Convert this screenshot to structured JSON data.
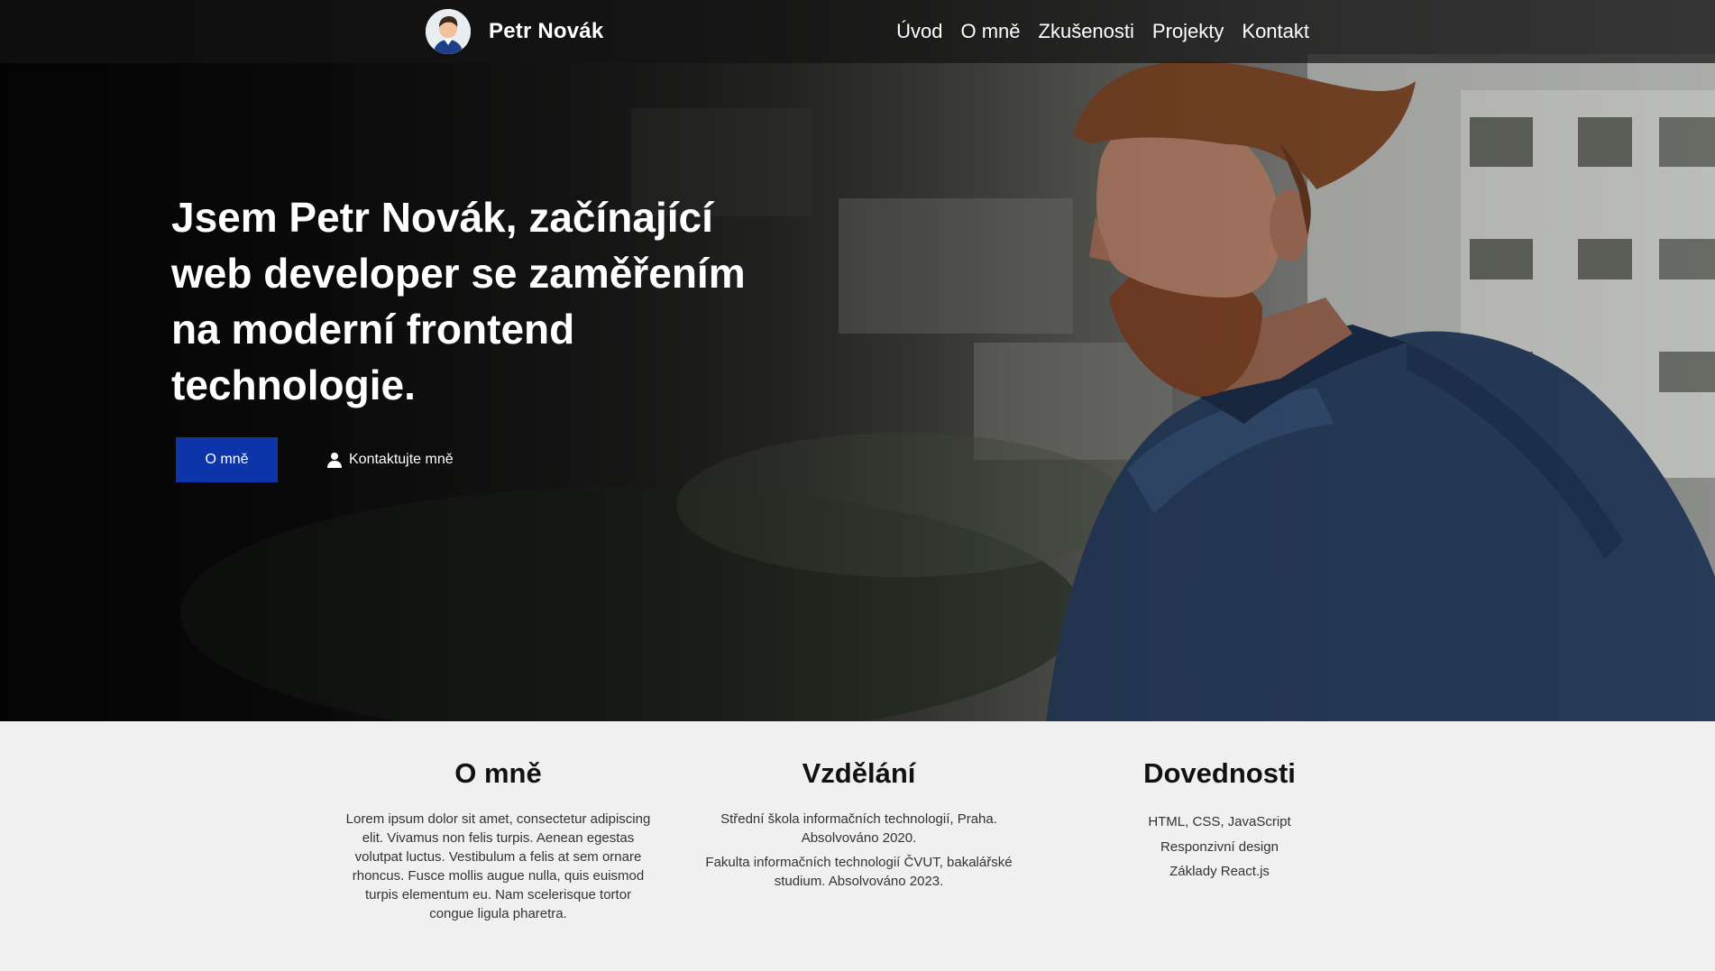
{
  "header": {
    "brand_name": "Petr Novák",
    "nav": [
      "Úvod",
      "O mně",
      "Zkušenosti",
      "Projekty",
      "Kontakt"
    ]
  },
  "hero": {
    "title": "Jsem Petr Novák, začínající web developer se zaměřením na moderní frontend technologie.",
    "primary_button": "O mně",
    "contact_link": "Kontaktujte mně",
    "accent_color": "#0d34a8"
  },
  "about": {
    "heading": "O mně",
    "text": "Lorem ipsum dolor sit amet, consectetur adipiscing elit. Vivamus non felis turpis. Aenean egestas volutpat luctus. Vestibulum a felis at sem ornare rhoncus. Fusce mollis augue nulla, quis euismod turpis elementum eu. Nam scelerisque tortor congue ligula pharetra."
  },
  "education": {
    "heading": "Vzdělání",
    "items": [
      "Střední škola informačních technologií, Praha. Absolvováno 2020.",
      "Fakulta informačních technologií ČVUT, bakalářské studium. Absolvováno 2023."
    ]
  },
  "skills": {
    "heading": "Dovednosti",
    "items": [
      "HTML, CSS, JavaScript",
      "Responzivní design",
      "Základy React.js"
    ]
  }
}
